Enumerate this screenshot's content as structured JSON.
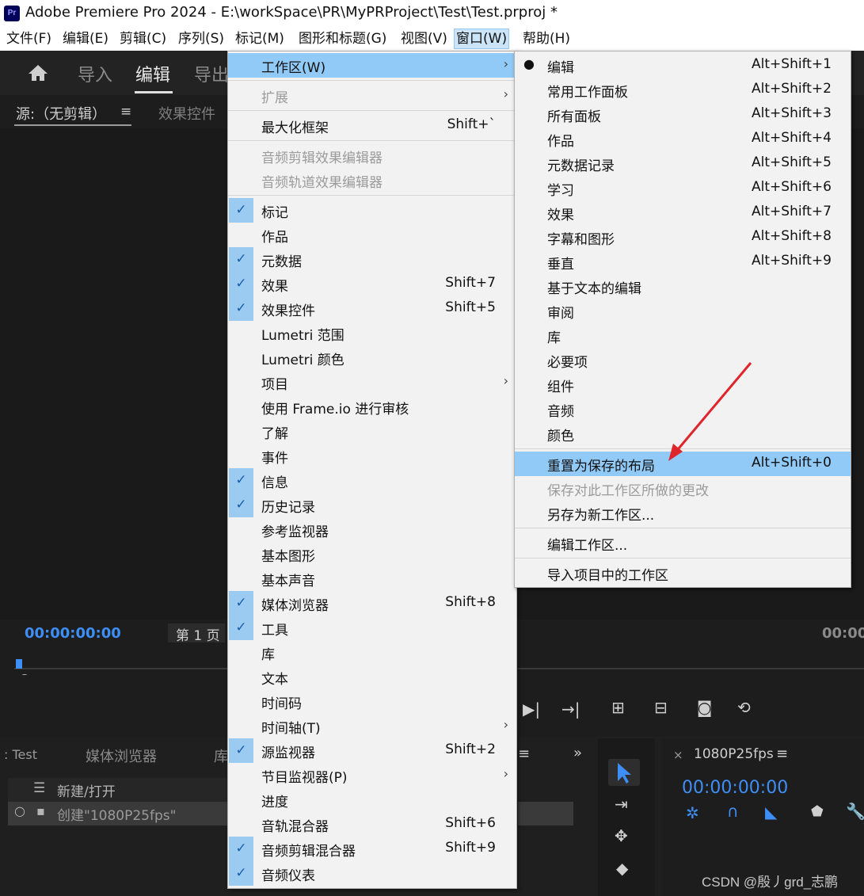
{
  "window": {
    "title": "Adobe Premiere Pro 2024 - E:\\workSpace\\PR\\MyPRProject\\Test\\Test.prproj *",
    "app_icon": "Pr"
  },
  "menubar": [
    "文件(F)",
    "编辑(E)",
    "剪辑(C)",
    "序列(S)",
    "标记(M)",
    "图形和标题(G)",
    "视图(V)",
    "窗口(W)",
    "帮助(H)"
  ],
  "header": {
    "import": "导入",
    "edit": "编辑",
    "export": "导出"
  },
  "source_panel": {
    "tab_source": "源:（无剪辑）",
    "tab_effects": "效果控件",
    "timecode": "00:00:00:00",
    "page": "第 1 页",
    "timecode_right": "00:00"
  },
  "project_panel": {
    "tab_project": ": Test",
    "tab_media": "媒体浏览器",
    "tab_lib": "库",
    "new_open": "新建/打开",
    "create_seq": "创建\"1080P25fps\""
  },
  "timeline_panel": {
    "tab": "1080P25fps",
    "timecode": "00:00:00:00"
  },
  "watermark": "CSDN @殷丿grd_志鹏",
  "window_menu": [
    {
      "label": "工作区(W)",
      "shortcut": "",
      "submenu": true,
      "highlight": true
    },
    {
      "sep": true
    },
    {
      "label": "扩展",
      "submenu": true,
      "disabled": true
    },
    {
      "sep": true
    },
    {
      "label": "最大化框架",
      "shortcut": "Shift+`"
    },
    {
      "sep": true
    },
    {
      "label": "音频剪辑效果编辑器",
      "disabled": true
    },
    {
      "label": "音频轨道效果编辑器",
      "disabled": true
    },
    {
      "sep": true
    },
    {
      "label": "标记",
      "checked": true
    },
    {
      "label": "作品"
    },
    {
      "label": "元数据",
      "checked": true
    },
    {
      "label": "效果",
      "checked": true,
      "shortcut": "Shift+7"
    },
    {
      "label": "效果控件",
      "checked": true,
      "shortcut": "Shift+5"
    },
    {
      "label": "Lumetri 范围"
    },
    {
      "label": "Lumetri 颜色"
    },
    {
      "label": "项目",
      "submenu": true
    },
    {
      "label": "使用 Frame.io 进行审核"
    },
    {
      "label": "了解"
    },
    {
      "label": "事件"
    },
    {
      "label": "信息",
      "checked": true
    },
    {
      "label": "历史记录",
      "checked": true
    },
    {
      "label": "参考监视器"
    },
    {
      "label": "基本图形"
    },
    {
      "label": "基本声音"
    },
    {
      "label": "媒体浏览器",
      "checked": true,
      "shortcut": "Shift+8"
    },
    {
      "label": "工具",
      "checked": true
    },
    {
      "label": "库"
    },
    {
      "label": "文本"
    },
    {
      "label": "时间码"
    },
    {
      "label": "时间轴(T)",
      "submenu": true
    },
    {
      "label": "源监视器",
      "checked": true,
      "shortcut": "Shift+2"
    },
    {
      "label": "节目监视器(P)",
      "submenu": true
    },
    {
      "label": "进度"
    },
    {
      "label": "音轨混合器",
      "shortcut": "Shift+6"
    },
    {
      "label": "音频剪辑混合器",
      "checked": true,
      "shortcut": "Shift+9"
    },
    {
      "label": "音频仪表",
      "checked": true
    }
  ],
  "workspace_menu": [
    {
      "label": "编辑",
      "shortcut": "Alt+Shift+1",
      "selected": true
    },
    {
      "label": "常用工作面板",
      "shortcut": "Alt+Shift+2"
    },
    {
      "label": "所有面板",
      "shortcut": "Alt+Shift+3"
    },
    {
      "label": "作品",
      "shortcut": "Alt+Shift+4"
    },
    {
      "label": "元数据记录",
      "shortcut": "Alt+Shift+5"
    },
    {
      "label": "学习",
      "shortcut": "Alt+Shift+6"
    },
    {
      "label": "效果",
      "shortcut": "Alt+Shift+7"
    },
    {
      "label": "字幕和图形",
      "shortcut": "Alt+Shift+8"
    },
    {
      "label": "垂直",
      "shortcut": "Alt+Shift+9"
    },
    {
      "label": "基于文本的编辑"
    },
    {
      "label": "审阅"
    },
    {
      "label": "库"
    },
    {
      "label": "必要项"
    },
    {
      "label": "组件"
    },
    {
      "label": "音频"
    },
    {
      "label": "颜色"
    },
    {
      "sep": true
    },
    {
      "label": "重置为保存的布局",
      "shortcut": "Alt+Shift+0",
      "highlight": true
    },
    {
      "label": "保存对此工作区所做的更改",
      "disabled": true
    },
    {
      "label": "另存为新工作区..."
    },
    {
      "sep": true
    },
    {
      "label": "编辑工作区..."
    },
    {
      "sep": true
    },
    {
      "label": "导入项目中的工作区"
    }
  ],
  "colors": {
    "menu_bg": "#f2f2f2",
    "highlight": "#91c9f7",
    "check_bg": "#9ccbf2",
    "accent_blue": "#3e8ef7",
    "arrow_red": "#e0242b"
  }
}
